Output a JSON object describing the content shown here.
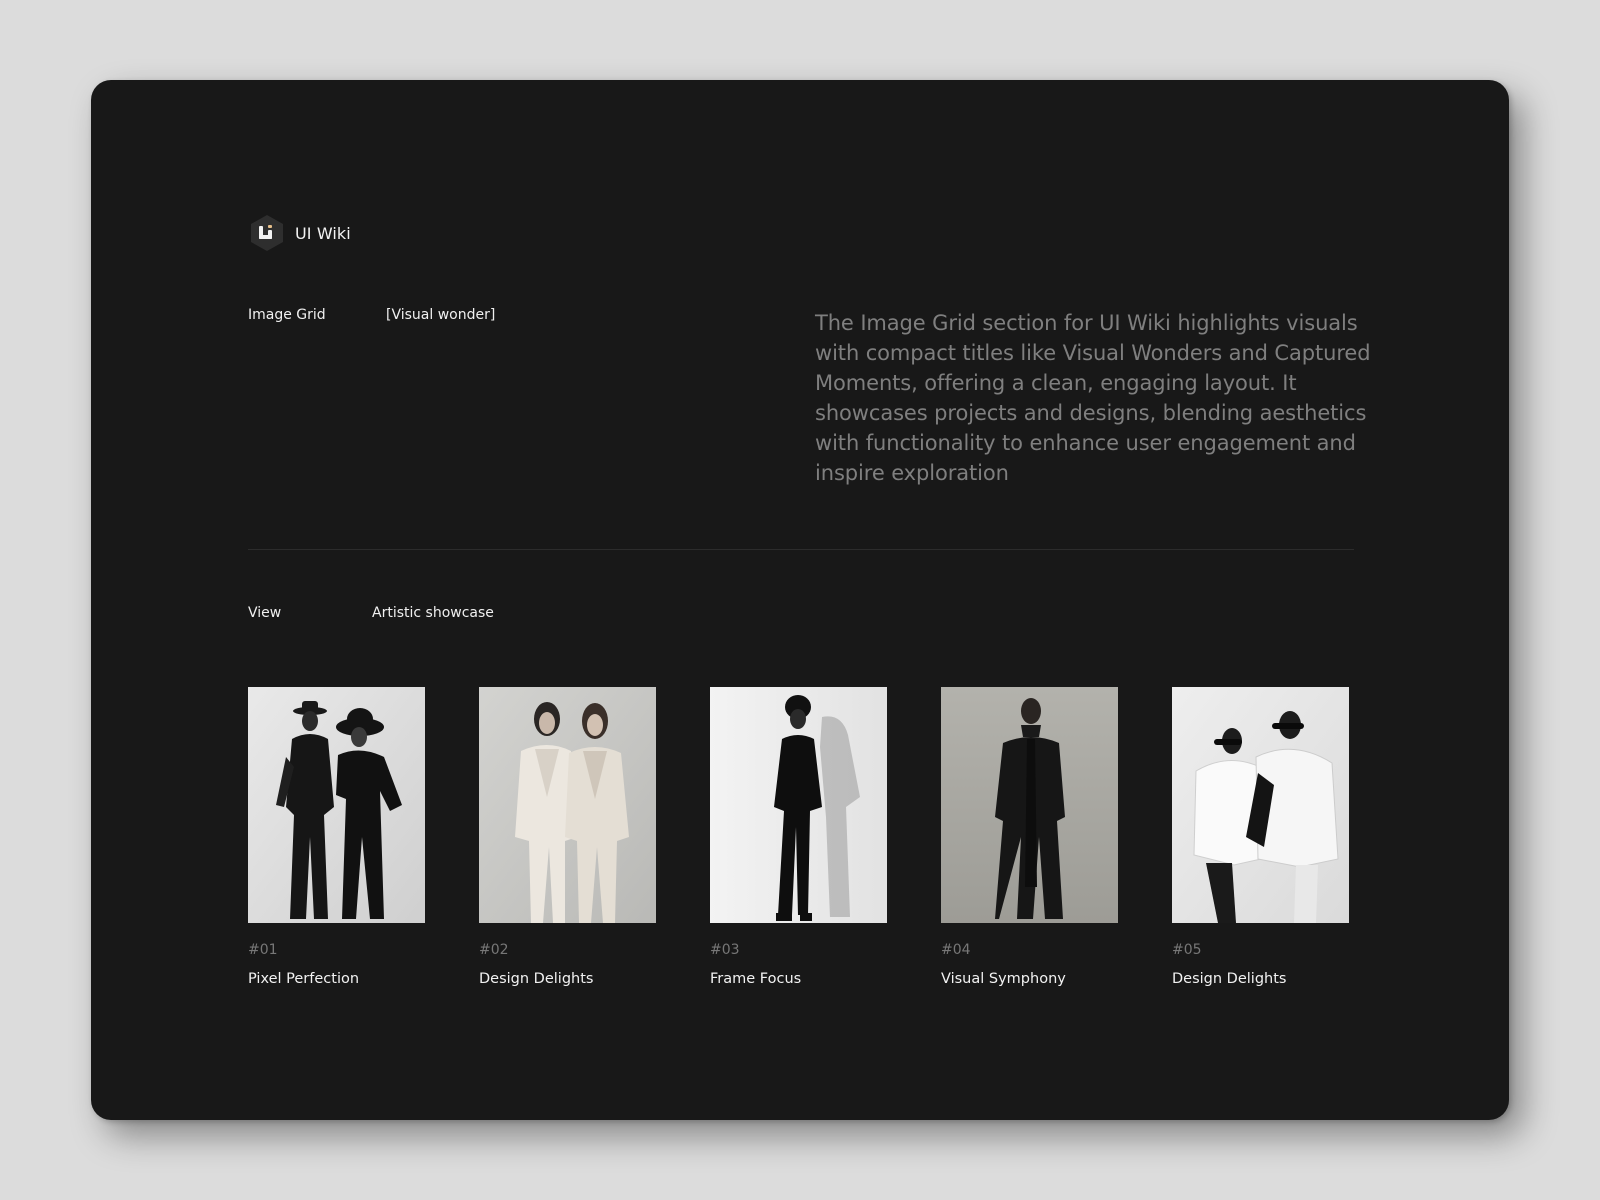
{
  "brand": {
    "name": "UI Wiki",
    "logo_letters": "ui"
  },
  "header": {
    "section_label": "Image Grid",
    "section_tag": "[Visual wonder]",
    "intro": "The Image Grid section for UI Wiki highlights visuals with compact titles like Visual Wonders and Captured Moments, offering a clean, engaging layout. It showcases projects and designs, blending aesthetics with functionality to enhance user engagement and inspire exploration"
  },
  "view": {
    "label": "View",
    "value": "Artistic showcase"
  },
  "gallery": [
    {
      "number": "#01",
      "title": "Pixel Perfection",
      "image": "two-figures-black-outfits-hats"
    },
    {
      "number": "#02",
      "title": "Design Delights",
      "image": "two-figures-cream-suits"
    },
    {
      "number": "#03",
      "title": "Frame Focus",
      "image": "single-figure-black-with-shadow"
    },
    {
      "number": "#04",
      "title": "Visual Symphony",
      "image": "single-figure-long-black-coat"
    },
    {
      "number": "#05",
      "title": "Design Delights",
      "image": "two-figures-white-puffer-jackets"
    }
  ],
  "colors": {
    "page_background": "#dcdcdc",
    "card_background": "#181818",
    "text_primary": "#f2f2f2",
    "text_muted": "#7f7f7f",
    "logo_accent": "#e7c08b"
  }
}
